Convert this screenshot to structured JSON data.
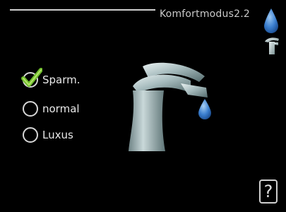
{
  "header": {
    "title": "Komfortmodus2.2"
  },
  "icons": {
    "top_right_drop": "water-drop-icon",
    "top_right_tap": "faucet-icon",
    "center": "faucet-with-drop-icon",
    "help": "help-icon"
  },
  "options": [
    {
      "label": "Sparm.",
      "selected": true
    },
    {
      "label": "normal",
      "selected": false
    },
    {
      "label": "Luxus",
      "selected": false
    }
  ],
  "help": {
    "label": "?"
  },
  "colors": {
    "background": "#000000",
    "check_green": "#6fbf2c",
    "drop_blue": "#4a8fd6",
    "faucet_metal": "#9fb3b5"
  }
}
